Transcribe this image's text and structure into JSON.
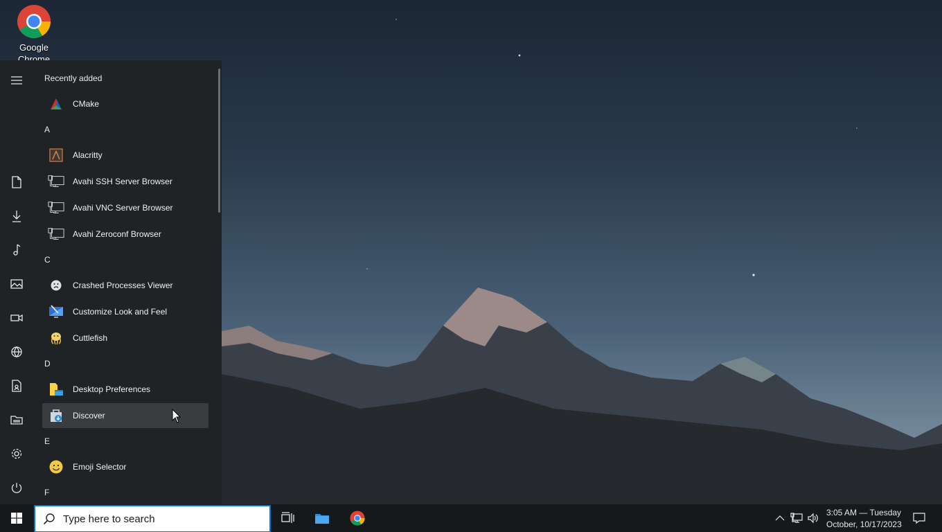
{
  "desktop": {
    "icons": [
      {
        "label": "Google Chrome",
        "icon": "chrome-icon"
      }
    ]
  },
  "start_menu": {
    "rail": [
      {
        "icon": "hamburger-menu-icon"
      },
      {
        "icon": "documents-icon"
      },
      {
        "icon": "downloads-icon"
      },
      {
        "icon": "music-icon"
      },
      {
        "icon": "pictures-icon"
      },
      {
        "icon": "videos-icon"
      },
      {
        "icon": "network-icon"
      },
      {
        "icon": "personal-folder-icon"
      },
      {
        "icon": "file-explorer-icon"
      },
      {
        "icon": "settings-icon"
      },
      {
        "icon": "power-icon"
      }
    ],
    "sections": {
      "recent": "Recently added",
      "a": "A",
      "c": "C",
      "d": "D",
      "e": "E",
      "f": "F"
    },
    "apps": {
      "cmake": "CMake",
      "alacritty": "Alacritty",
      "avahi_ssh": "Avahi SSH Server Browser",
      "avahi_vnc": "Avahi VNC Server Browser",
      "avahi_zeroconf": "Avahi Zeroconf Browser",
      "crashed": "Crashed Processes Viewer",
      "customize": "Customize Look and Feel",
      "cuttlefish": "Cuttlefish",
      "desktop_prefs": "Desktop Preferences",
      "discover": "Discover",
      "emoji": "Emoji Selector"
    },
    "hovered_item": "Discover"
  },
  "taskbar": {
    "search": {
      "placeholder": "Type here to search",
      "value": ""
    },
    "pinned": [
      {
        "icon": "task-view-icon"
      },
      {
        "icon": "file-explorer-icon"
      },
      {
        "icon": "chrome-icon"
      }
    ],
    "clock": {
      "time_line": "3:05 AM — Tuesday",
      "date_line": "October, 10/17/2023"
    }
  },
  "colors": {
    "accent": "#0a74d6",
    "menu_bg": "#202326",
    "taskbar_bg": "#16191c",
    "hover_bg": "#3a3d40"
  }
}
